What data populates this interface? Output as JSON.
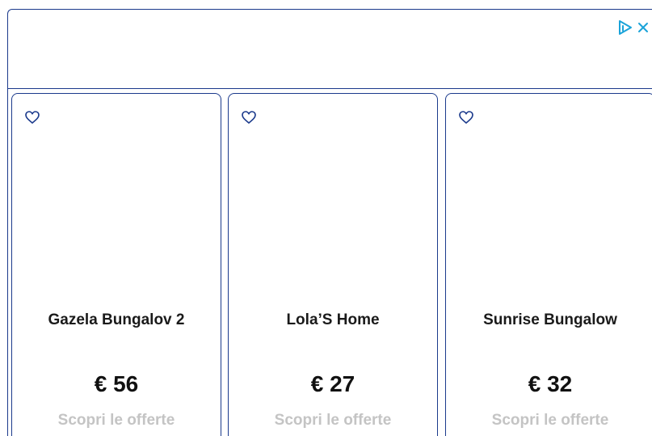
{
  "colors": {
    "border": "#1b3a8c",
    "accent": "#1aa3d9",
    "title": "#1a1a1a",
    "price": "#111111",
    "cta": "#c4c4c4"
  },
  "ad": {
    "choices_icon": "adchoices-icon",
    "close_icon": "close-icon"
  },
  "cards": [
    {
      "title": "Gazela Bungalov 2",
      "price": "€ 56",
      "cta": "Scopri le offerte",
      "icon": "heart-icon"
    },
    {
      "title": "Lola’S Home",
      "price": "€ 27",
      "cta": "Scopri le offerte",
      "icon": "heart-icon"
    },
    {
      "title": "Sunrise Bungalow",
      "price": "€ 32",
      "cta": "Scopri le offerte",
      "icon": "heart-icon"
    }
  ]
}
